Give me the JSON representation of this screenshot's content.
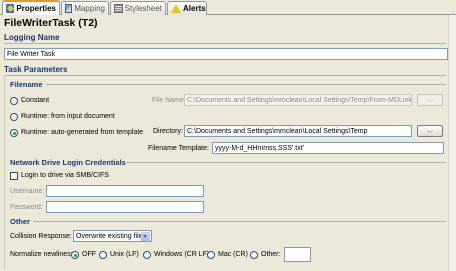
{
  "tabs": [
    {
      "label": "Properties",
      "icon": "properties-icon",
      "active": true
    },
    {
      "label": "Mapping",
      "icon": "mapping-icon",
      "active": false
    },
    {
      "label": "Stylesheet",
      "icon": "stylesheet-icon",
      "active": false
    },
    {
      "label": "Alerts",
      "icon": "alert-icon",
      "active": false
    }
  ],
  "title": "FileWriterTask  (T2)",
  "logging": {
    "heading": "Logging Name",
    "value": "File Writer Task"
  },
  "task_params": {
    "heading": "Task Parameters",
    "filename": {
      "heading": "Filename",
      "radio_constant": "Constant",
      "radio_input": "Runtime: from input document",
      "radio_auto": "Runtime: auto-generated from template",
      "selected": "auto",
      "file_name_label": "File Name:",
      "file_name_value": "C:\\Documents and Settings\\mmclean\\Local Settings\\Temp\\From-MDLink.txt",
      "file_name_button": "...",
      "directory_label": "Directory:",
      "directory_value": "C:\\Documents and Settings\\mmclean\\Local Settings\\Temp",
      "directory_button": "...",
      "template_label": "Filename Template:",
      "template_value": "yyyy-M-d_HHmmss.SSS'.txt'"
    },
    "network": {
      "heading": "Network Drive Login Credentials",
      "checkbox_label": "Login to drive via SMB/CIFS",
      "checked": false,
      "username_label": "Username:",
      "username_value": "",
      "password_label": "Password:",
      "password_value": ""
    },
    "other": {
      "heading": "Other",
      "collision_label": "Collision Response:",
      "collision_value": "Overwrite existing file",
      "newline_label": "Normalize newlines:",
      "newline_options": [
        "OFF",
        "Unix (LF)",
        "Windows (CR LF)",
        "Mac (CR)",
        "Other:"
      ],
      "newline_selected": "OFF",
      "other_value": ""
    }
  },
  "colors": {
    "section_heading": "#16377a",
    "active_tab_accent": "#e69a2e",
    "background": "#ece9d8"
  }
}
